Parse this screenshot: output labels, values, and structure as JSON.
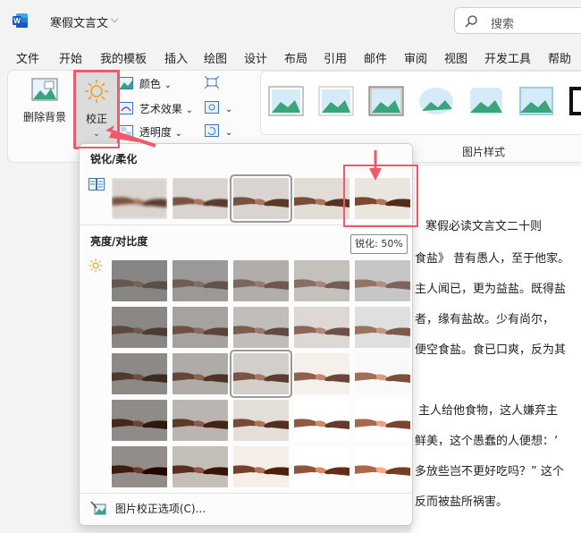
{
  "title_bar": {
    "doc_title": "寒假文言文",
    "search_placeholder": "搜索"
  },
  "menu": [
    "文件",
    "开始",
    "我的模板",
    "插入",
    "绘图",
    "设计",
    "布局",
    "引用",
    "邮件",
    "审阅",
    "视图",
    "开发工具",
    "帮助"
  ],
  "ribbon": {
    "remove_bg": "删除背景",
    "correct": "校正",
    "color": "颜色",
    "artistic": "艺术效果",
    "transparency": "透明度",
    "styles_group": "图片样式"
  },
  "dropdown": {
    "sharpen_title": "锐化/柔化",
    "brightness_title": "亮度/对比度",
    "options": "图片校正选项(C)...",
    "tooltip": "锐化: 50%",
    "sharpen_count": 5,
    "brightness_rows": 5,
    "brightness_cols": 5
  },
  "document": {
    "lines": [
      "寒假必读文言文二十则",
      "食盐》 昔有愚人，至于他家。",
      "主人闻已，更为益盐。既得盐",
      "者，缘有盐故。少有尚尔，",
      "便空食盐。食已口爽，反为其",
      "主人给他食物，这人嫌弃主",
      "鲜美，这个愚蠢的人便想：‘",
      "多放些岂不更好吃吗？” 这个",
      "反而被盐所祸害。"
    ]
  },
  "colors": {
    "accent_red": "#ef5a6b",
    "word_blue": "#185abd"
  }
}
